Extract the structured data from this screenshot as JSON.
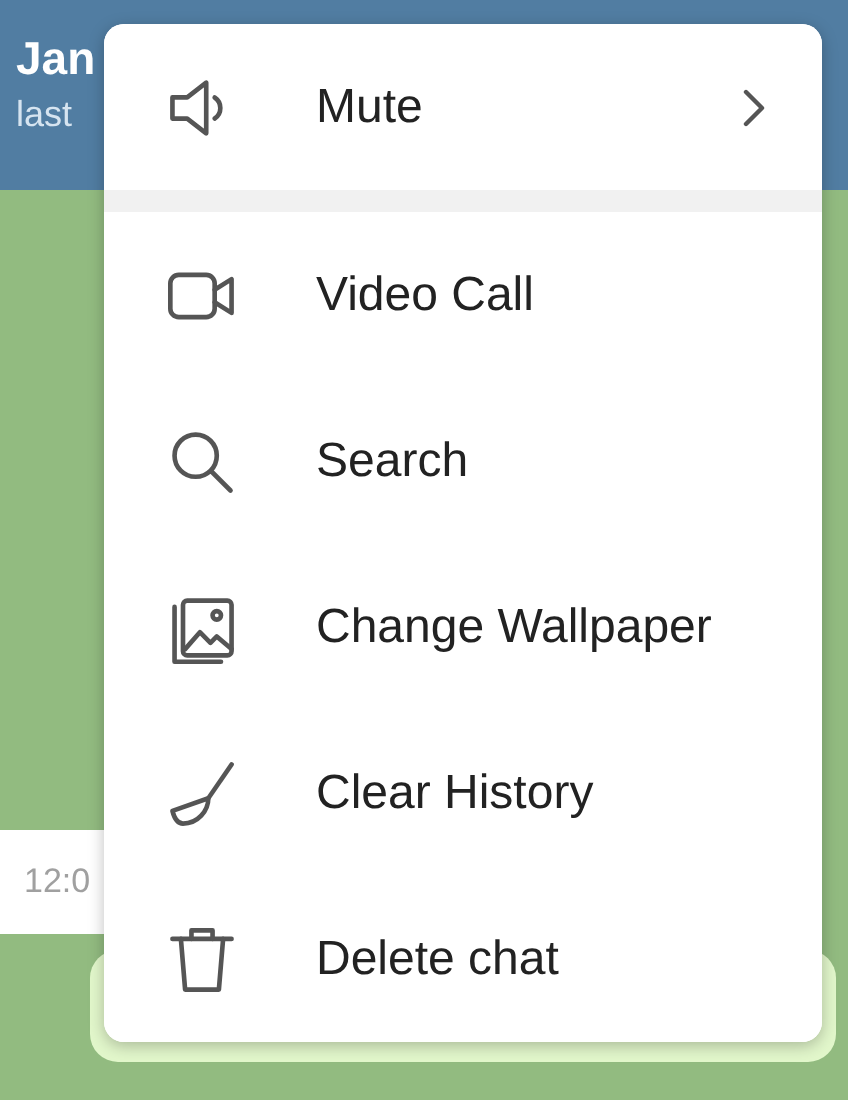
{
  "header": {
    "title": "Jan",
    "status": "last"
  },
  "messages": [
    {
      "time": "12:0",
      "outgoing": false
    },
    {
      "outgoing": true
    }
  ],
  "menu": {
    "sections": [
      {
        "items": [
          {
            "label": "Mute",
            "submenu": true,
            "kind": "speaker"
          }
        ]
      },
      {
        "items": [
          {
            "label": "Video Call",
            "submenu": false,
            "kind": "video"
          },
          {
            "label": "Search",
            "submenu": false,
            "kind": "search"
          },
          {
            "label": "Change Wallpaper",
            "submenu": false,
            "kind": "wallpaper"
          },
          {
            "label": "Clear History",
            "submenu": false,
            "kind": "broom"
          },
          {
            "label": "Delete chat",
            "submenu": false,
            "kind": "trash"
          }
        ]
      }
    ]
  }
}
